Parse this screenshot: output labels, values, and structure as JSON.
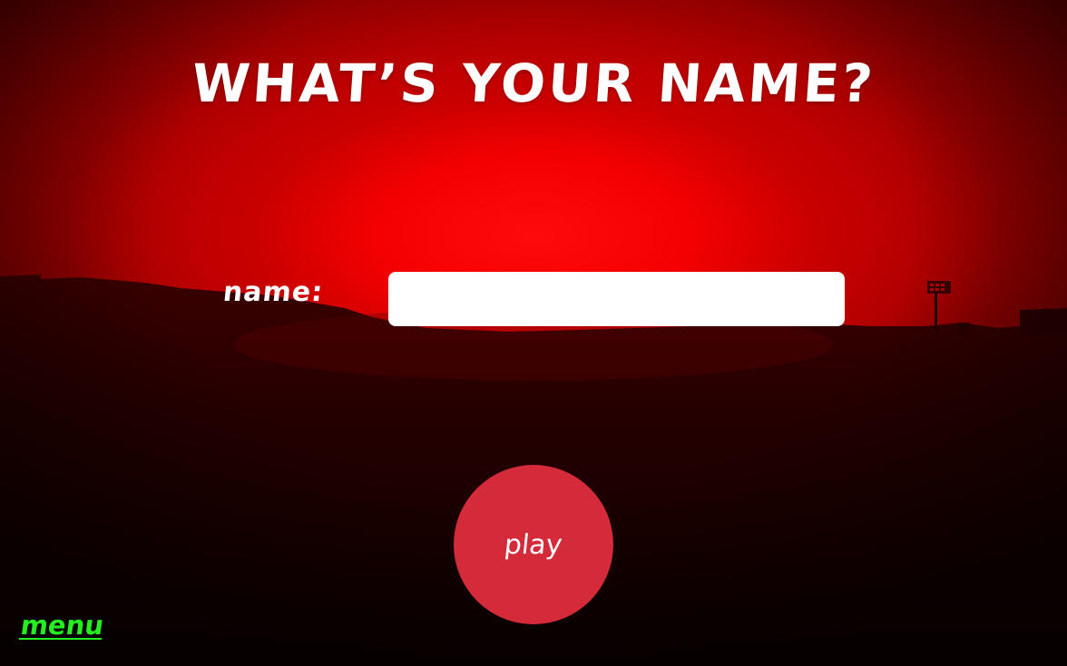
{
  "page": {
    "title": "WHAT’S YOUR NAME?"
  },
  "form": {
    "name_label": "name:",
    "name_value": "",
    "name_placeholder": ""
  },
  "actions": {
    "play_label": "play",
    "menu_label": "menu"
  },
  "colors": {
    "sky_bright": "#ff0a0a",
    "sky_dark": "#3d0000",
    "input_bg": "#ffffff",
    "play_button_bg": "#d42a3a",
    "menu_link": "#22ee22",
    "text": "#ffffff"
  }
}
